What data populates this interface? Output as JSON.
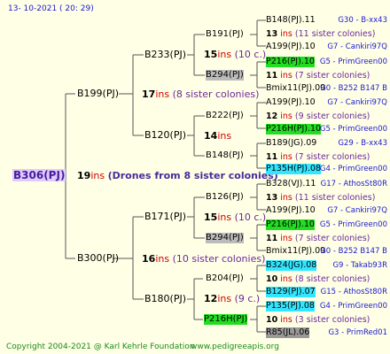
{
  "header": {
    "date": "13- 10-2021 ( 20: 29)"
  },
  "footer": {
    "copyright": "Copyright 2004-2021 @ Karl Kehrle Foundation",
    "url": "www.pedigreeapis.org"
  },
  "root": {
    "name": "B306(PJ)",
    "ins_n": "19",
    "ins_w": "ins",
    "note": "(Drones from 8 sister colonies)"
  },
  "gen1": [
    {
      "name": "B199(PJ)",
      "ins_n": "17",
      "ins_w": "ins",
      "note": "(8 sister colonies)"
    },
    {
      "name": "B300(PJ)",
      "ins_n": "16",
      "ins_w": "ins",
      "note": "(10 sister colonies)"
    }
  ],
  "gen2": [
    {
      "name": "B233(PJ)",
      "ins_n": "15",
      "ins_w": "ins",
      "note": "(10 c.)"
    },
    {
      "name": "B120(PJ)",
      "ins_n": "14",
      "ins_w": "ins",
      "note": ""
    },
    {
      "name": "B171(PJ)",
      "ins_n": "15",
      "ins_w": "ins",
      "note": "(10 c.)"
    },
    {
      "name": "B180(PJ)",
      "ins_n": "12",
      "ins_w": "ins",
      "note": "(9 c.)"
    }
  ],
  "gen3": [
    {
      "name": "B191(PJ)"
    },
    {
      "name": "B294(PJ)"
    },
    {
      "name": "B222(PJ)"
    },
    {
      "name": "B148(PJ)"
    },
    {
      "name": "B126(PJ)"
    },
    {
      "name": "B294(PJ)"
    },
    {
      "name": "B204(PJ)"
    },
    {
      "name": "P216H(PJ)"
    }
  ],
  "gen4": [
    {
      "name": "B148(PJ).11",
      "src": "G30 - B-xx43"
    },
    {
      "ins_n": "13",
      "ins_w": "ins",
      "note": "(11 sister colonies)"
    },
    {
      "name": "A199(PJ).10",
      "src": "G7 - Cankiri97Q"
    },
    {
      "name": "P216(PJ).10",
      "src": "G5 - PrimGreen00"
    },
    {
      "ins_n": "11",
      "ins_w": "ins",
      "note": "(7 sister colonies)"
    },
    {
      "name": "Bmix11(PJ).09",
      "src": "G0 - B252 B147 B"
    },
    {
      "name": "A199(PJ).10",
      "src": "G7 - Cankiri97Q"
    },
    {
      "ins_n": "12",
      "ins_w": "ins",
      "note": "(9 sister colonies)"
    },
    {
      "name": "P216H(PJ).10",
      "src": "G5 - PrimGreen00"
    },
    {
      "name": "B189(JG).09",
      "src": "G29 - B-xx43"
    },
    {
      "ins_n": "11",
      "ins_w": "ins",
      "note": "(7 sister colonies)"
    },
    {
      "name": "P135H(PJ).08",
      "src": "G4 - PrimGreen00"
    },
    {
      "name": "B328(VJ).11",
      "src": "G17 - AthosSt80R"
    },
    {
      "ins_n": "13",
      "ins_w": "ins",
      "note": "(11 sister colonies)"
    },
    {
      "name": "A199(PJ).10",
      "src": "G7 - Cankiri97Q"
    },
    {
      "name": "P216(PJ).10",
      "src": "G5 - PrimGreen00"
    },
    {
      "ins_n": "11",
      "ins_w": "ins",
      "note": "(7 sister colonies)"
    },
    {
      "name": "Bmix11(PJ).09",
      "src": "G0 - B252 B147 B"
    },
    {
      "name": "B324(JG).08",
      "src": "G9 - Takab93R"
    },
    {
      "ins_n": "10",
      "ins_w": "ins",
      "note": "(8 sister colonies)"
    },
    {
      "name": "B129(PJ).07",
      "src": "G15 - AthosSt80R"
    },
    {
      "name": "P135(PJ).08",
      "src": "G4 - PrimGreen00"
    },
    {
      "ins_n": "10",
      "ins_w": "ins",
      "note": "(3 sister colonies)"
    },
    {
      "name": "R85(JL).06",
      "src": "G3 - PrimRed01"
    }
  ],
  "colors": {
    "background": "#ffffe6",
    "lines": "#555555",
    "highlight_green": "#22dd22",
    "highlight_cyan": "#33e6ff",
    "highlight_gray": "#bbbbbb",
    "ins_red": "#d00000",
    "header_blue": "#1a1ad0",
    "footer_green": "#1a8a1a"
  }
}
